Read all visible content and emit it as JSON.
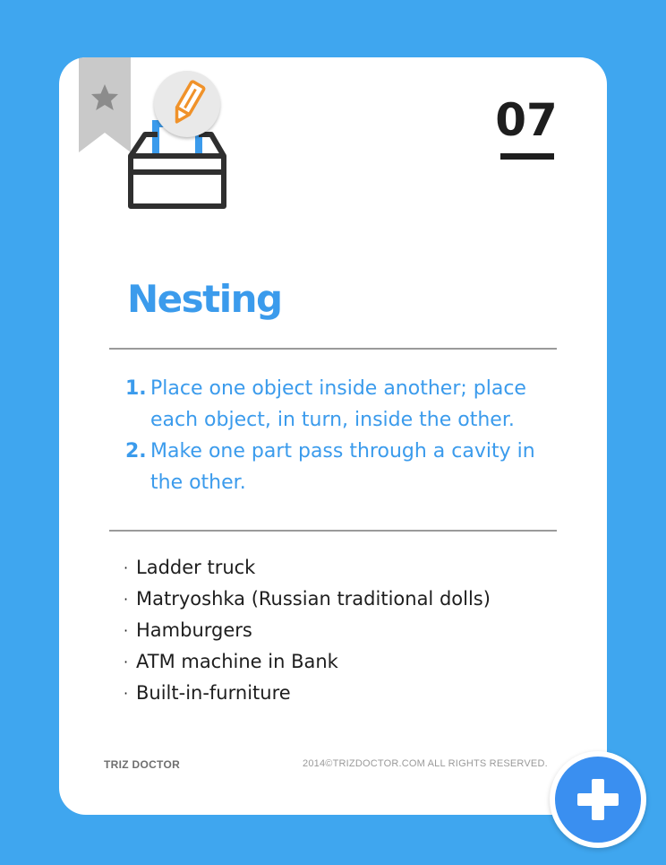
{
  "card": {
    "number": "07",
    "title": "Nesting",
    "principles": [
      {
        "num": "1.",
        "text": "Place one object inside another; place each object, in turn, inside the other."
      },
      {
        "num": "2.",
        "text": "Make one part pass through a cavity in the other."
      }
    ],
    "examples": [
      "Ladder truck",
      "Matryoshka (Russian traditional dolls)",
      "Hamburgers",
      "ATM machine in Bank",
      "Built-in-furniture"
    ],
    "bullet": "·",
    "footer_brand": "TRIZ DOCTOR",
    "footer_copyright": "2014©TRIZDOCTOR.COM  ALL RIGHTS RESERVED."
  },
  "icons": {
    "bookmark": "star-bookmark-icon",
    "illustration": "nesting-box-icon",
    "edit": "pencil-icon",
    "add": "plus-icon"
  },
  "colors": {
    "background": "#3fa6ef",
    "accent": "#3b9bec",
    "fab": "#3a8ff0",
    "pencil": "#f0922a"
  }
}
